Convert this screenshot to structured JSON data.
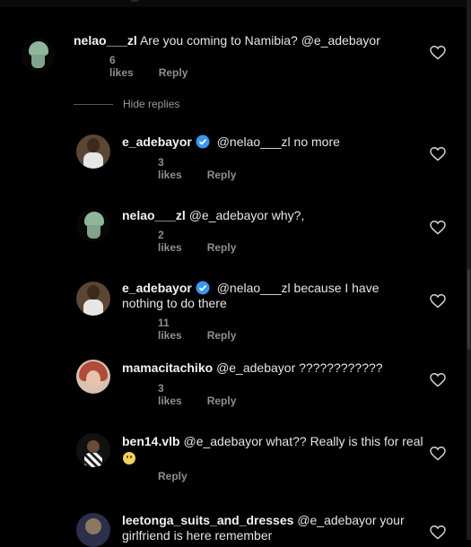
{
  "comments": [
    {
      "username": "nelao___zl",
      "verified": false,
      "text": "Are you coming to Namibia? @e_adebayor",
      "likes": "6 likes",
      "reply": "Reply"
    },
    {
      "username": "e_adebayor",
      "verified": true,
      "text": "@nelao___zl no more",
      "likes": "3 likes",
      "reply": "Reply"
    },
    {
      "username": "nelao___zl",
      "verified": false,
      "text": "@e_adebayor  why?,",
      "likes": "2 likes",
      "reply": "Reply"
    },
    {
      "username": "e_adebayor",
      "verified": true,
      "text": "@nelao___zl because I have",
      "text2": "nothing to do there",
      "likes": "11 likes",
      "reply": "Reply"
    },
    {
      "username": "mamacitachiko",
      "verified": false,
      "text": "@e_adebayor ????????????",
      "likes": "3 likes",
      "reply": "Reply"
    },
    {
      "username": "ben14.vlb",
      "verified": false,
      "text": "@e_adebayor what?? Really is this for real",
      "reply": "Reply"
    },
    {
      "username": "leetonga_suits_and_dresses",
      "verified": false,
      "text": "@e_adebayor your",
      "text2": "girlfriend is here remember"
    }
  ],
  "hide_replies_label": "Hide replies",
  "colors": {
    "background": "#000000",
    "text": "#e6e6e6",
    "meta": "#8e8e8e",
    "verified": "#3897f0"
  },
  "icons": {
    "like": "heart-outline-icon",
    "verified": "verified-badge-icon"
  }
}
